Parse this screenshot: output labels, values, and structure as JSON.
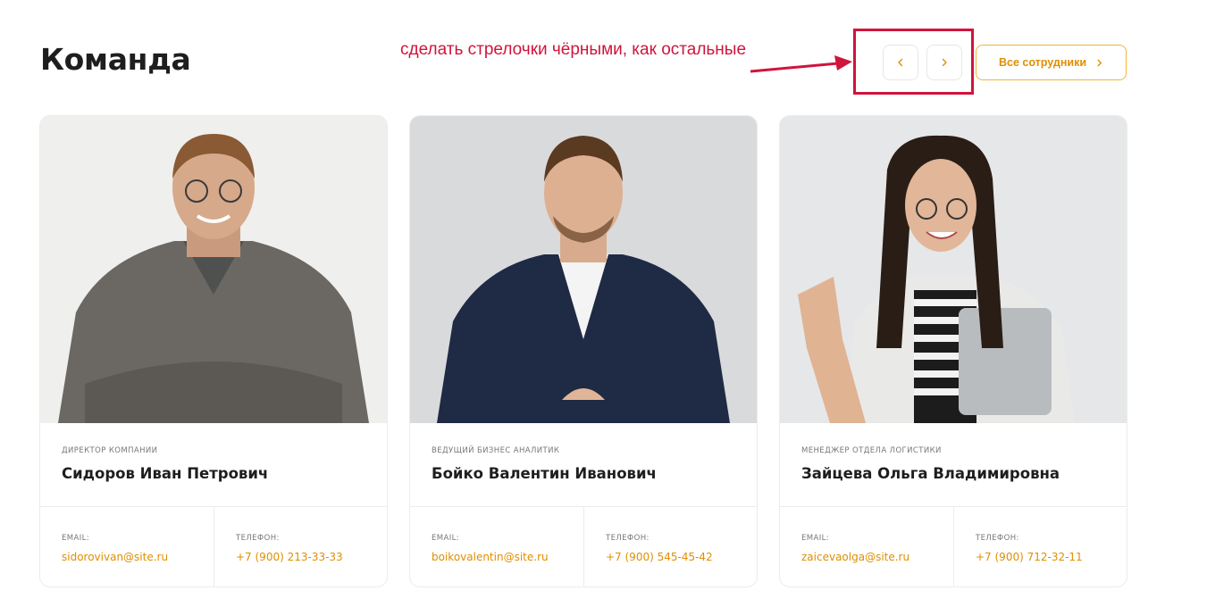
{
  "section": {
    "title": "Команда",
    "all_button_label": "Все сотрудники"
  },
  "annotation": {
    "text": "сделать стрелочки чёрными, как остальные",
    "color": "#d0143c"
  },
  "colors": {
    "accent": "#df8f00",
    "accent_border": "#f0b53a",
    "border": "#ececec",
    "annotation": "#d0143c"
  },
  "icons": {
    "prev": "chevron-left-icon",
    "next": "chevron-right-icon",
    "all": "chevron-right-icon"
  },
  "labels": {
    "email": "EMAIL:",
    "phone": "ТЕЛЕФОН:"
  },
  "employees": [
    {
      "role": "ДИРЕКТОР КОМПАНИИ",
      "name": "Сидоров Иван Петрович",
      "email": "sidorovivan@site.ru",
      "phone": "+7 (900) 213-33-33"
    },
    {
      "role": "ВЕДУЩИЙ БИЗНЕС АНАЛИТИК",
      "name": "Бойко Валентин Иванович",
      "email": "boikovalentin@site.ru",
      "phone": "+7 (900) 545-45-42"
    },
    {
      "role": "МЕНЕДЖЕР ОТДЕЛА ЛОГИСТИКИ",
      "name": "Зайцева Ольга Владимировна",
      "email": "zaicevaolga@site.ru",
      "phone": "+7 (900) 712-32-11"
    }
  ]
}
